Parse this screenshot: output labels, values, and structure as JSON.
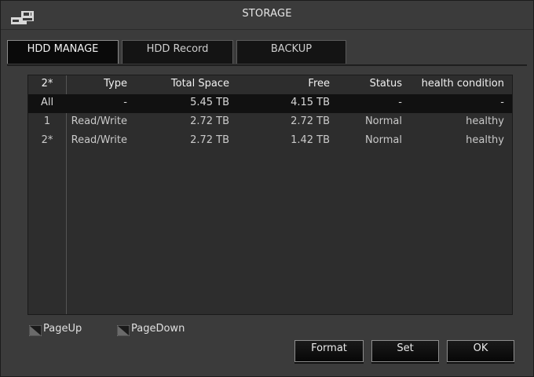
{
  "window": {
    "title": "STORAGE"
  },
  "tabs": [
    {
      "label": "HDD MANAGE",
      "active": true
    },
    {
      "label": "HDD Record",
      "active": false
    },
    {
      "label": "BACKUP",
      "active": false
    }
  ],
  "table": {
    "headers": [
      "2*",
      "Type",
      "Total Space",
      "Free",
      "Status",
      "health condition"
    ],
    "rows": [
      [
        "All",
        "-",
        "5.45 TB",
        "4.15 TB",
        "-",
        "-"
      ],
      [
        "1",
        "Read/Write",
        "2.72 TB",
        "2.72 TB",
        "Normal",
        "healthy"
      ],
      [
        "2*",
        "Read/Write",
        "2.72 TB",
        "1.42 TB",
        "Normal",
        "healthy"
      ]
    ]
  },
  "pager": {
    "page_up": "PageUp",
    "page_down": "PageDown"
  },
  "buttons": {
    "format": "Format",
    "set": "Set",
    "ok": "OK"
  },
  "icons": {
    "app": "hdd-disk-icon",
    "page_up": "page-up-icon",
    "page_down": "page-down-icon"
  },
  "colors": {
    "background": "#3b3b3b",
    "table_bg": "#2d2d2d",
    "highlight_row": "#111111",
    "button_border": "#8d8d8d"
  }
}
